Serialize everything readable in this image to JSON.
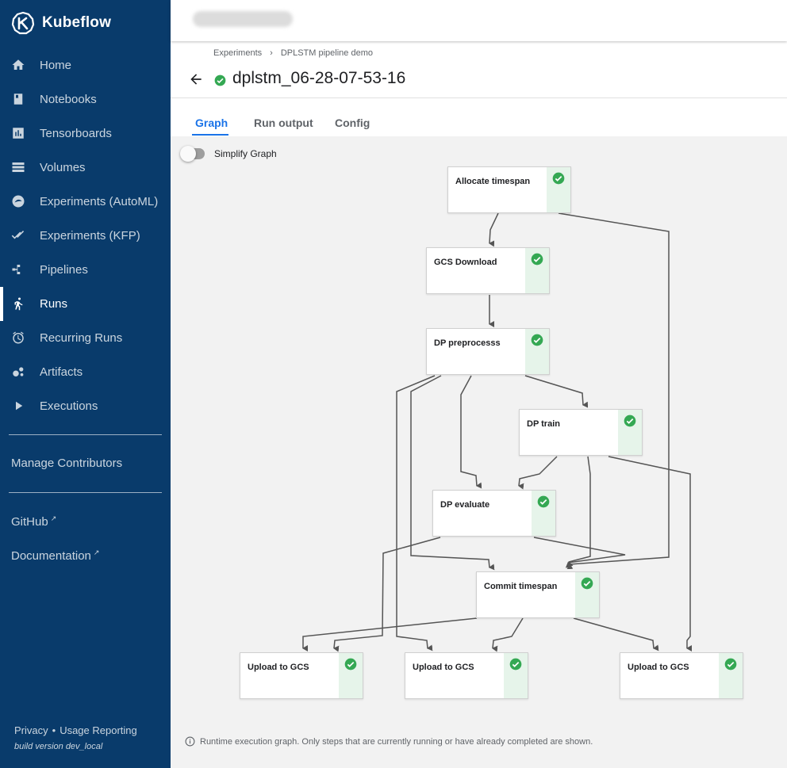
{
  "brand": {
    "name": "Kubeflow"
  },
  "sidebar": {
    "items": [
      {
        "label": "Home",
        "icon": "home-icon"
      },
      {
        "label": "Notebooks",
        "icon": "notebook-icon"
      },
      {
        "label": "Tensorboards",
        "icon": "chart-icon"
      },
      {
        "label": "Volumes",
        "icon": "storage-icon"
      },
      {
        "label": "Experiments (AutoML)",
        "icon": "automl-icon"
      },
      {
        "label": "Experiments (KFP)",
        "icon": "checks-icon"
      },
      {
        "label": "Pipelines",
        "icon": "pipeline-icon"
      },
      {
        "label": "Runs",
        "icon": "run-icon"
      },
      {
        "label": "Recurring Runs",
        "icon": "alarm-icon"
      },
      {
        "label": "Artifacts",
        "icon": "bubble-icon"
      },
      {
        "label": "Executions",
        "icon": "play-icon"
      }
    ],
    "active_item": "Runs",
    "manage_contributors": "Manage Contributors",
    "github": "GitHub",
    "documentation": "Documentation",
    "privacy": "Privacy",
    "usage_reporting": "Usage Reporting",
    "build_version": "build version dev_local"
  },
  "breadcrumb": {
    "parent": "Experiments",
    "current": "DPLSTM pipeline demo",
    "separator": "›"
  },
  "page": {
    "title": "dplstm_06-28-07-53-16",
    "status": "succeeded"
  },
  "tabs": [
    {
      "label": "Graph"
    },
    {
      "label": "Run output"
    },
    {
      "label": "Config"
    }
  ],
  "active_tab": "Graph",
  "graph": {
    "simplify_label": "Simplify Graph",
    "simplify_on": false,
    "nodes": [
      {
        "name": "Allocate timespan",
        "status": "succeeded"
      },
      {
        "name": "GCS Download",
        "status": "succeeded"
      },
      {
        "name": "DP preprocesss",
        "status": "succeeded"
      },
      {
        "name": "DP train",
        "status": "succeeded"
      },
      {
        "name": "DP evaluate",
        "status": "succeeded"
      },
      {
        "name": "Commit timespan",
        "status": "succeeded"
      },
      {
        "name": "Upload to GCS",
        "status": "succeeded"
      },
      {
        "name": "Upload to GCS",
        "status": "succeeded"
      },
      {
        "name": "Upload to GCS",
        "status": "succeeded"
      }
    ],
    "footer_note": "Runtime execution graph. Only steps that are currently running or have already completed are shown."
  },
  "colors": {
    "sidebar": "#093b6b",
    "accent": "#1a73e8",
    "success": "#34a853",
    "edge": "#555555"
  }
}
